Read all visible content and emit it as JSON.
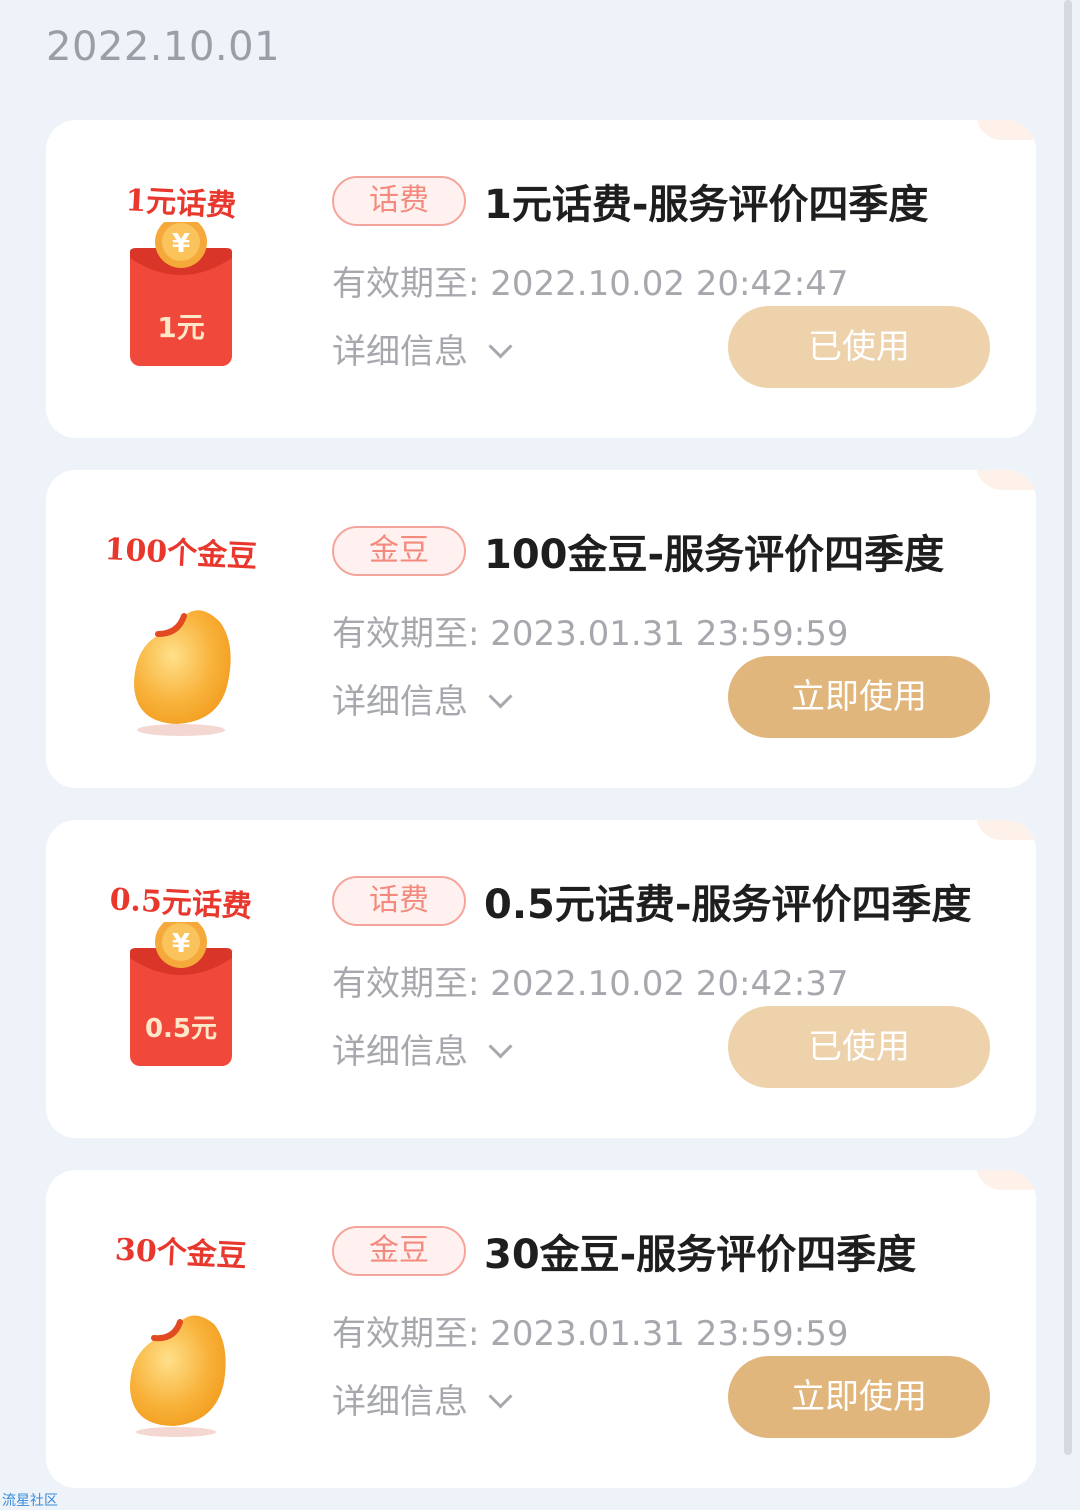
{
  "date_header": "2022.10.01",
  "watermark": "流星社区",
  "colors": {
    "background": "#eef3f9",
    "tag_border": "#f5a49b",
    "tag_text": "#f48a7e",
    "button_used": "#edd2ac",
    "button_active": "#e1b67d",
    "red_packet": "#f0483a",
    "bean": "#f7a620"
  },
  "cards": [
    {
      "thumb_label": "1元话费",
      "thumb_value": "1元",
      "thumb_icon": "red-packet-icon",
      "tag": "话费",
      "title": "1元话费-服务评价四季度",
      "validity_label": "有效期至:",
      "validity_value": "2022.10.02 20:42:47",
      "details_label": "详细信息",
      "button_label": "已使用",
      "button_state": "used"
    },
    {
      "thumb_label": "100个金豆",
      "thumb_icon": "gold-bean-icon",
      "tag": "金豆",
      "title": "100金豆-服务评价四季度",
      "validity_label": "有效期至:",
      "validity_value": "2023.01.31 23:59:59",
      "details_label": "详细信息",
      "button_label": "立即使用",
      "button_state": "active"
    },
    {
      "thumb_label": "0.5元话费",
      "thumb_value": "0.5元",
      "thumb_icon": "red-packet-icon",
      "tag": "话费",
      "title": "0.5元话费-服务评价四季度",
      "validity_label": "有效期至:",
      "validity_value": "2022.10.02 20:42:37",
      "details_label": "详细信息",
      "button_label": "已使用",
      "button_state": "used"
    },
    {
      "thumb_label": "30个金豆",
      "thumb_icon": "gold-bean-icon",
      "tag": "金豆",
      "title": "30金豆-服务评价四季度",
      "validity_label": "有效期至:",
      "validity_value": "2023.01.31 23:59:59",
      "details_label": "详细信息",
      "button_label": "立即使用",
      "button_state": "active"
    }
  ]
}
